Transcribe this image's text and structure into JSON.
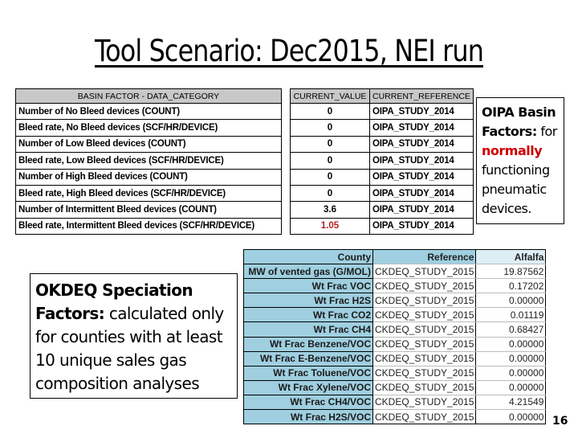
{
  "title": "Tool Scenario: Dec2015, NEI run",
  "basin_table": {
    "headers": [
      "BASIN FACTOR - DATA_CATEGORY",
      "CURRENT_VALUE",
      "CURRENT_REFERENCE"
    ],
    "rows": [
      {
        "category": "Number of No Bleed devices (COUNT)",
        "value": "0",
        "reference": "OIPA_STUDY_2014"
      },
      {
        "category": "Bleed rate, No Bleed devices (SCF/HR/DEVICE)",
        "value": "0",
        "reference": "OIPA_STUDY_2014"
      },
      {
        "category": "Number of Low Bleed devices (COUNT)",
        "value": "0",
        "reference": "OIPA_STUDY_2014"
      },
      {
        "category": "Bleed rate, Low Bleed devices (SCF/HR/DEVICE)",
        "value": "0",
        "reference": "OIPA_STUDY_2014"
      },
      {
        "category": "Number of High Bleed devices (COUNT)",
        "value": "0",
        "reference": "OIPA_STUDY_2014"
      },
      {
        "category": "Bleed rate, High Bleed devices (SCF/HR/DEVICE)",
        "value": "0",
        "reference": "OIPA_STUDY_2014"
      },
      {
        "category": "Number of Intermittent Bleed devices (COUNT)",
        "value": "3.6",
        "reference": "OIPA_STUDY_2014"
      },
      {
        "category": "Bleed rate, Intermittent Bleed devices (SCF/HR/DEVICE)",
        "value": "1.05",
        "reference": "OIPA_STUDY_2014",
        "highlight": true
      }
    ]
  },
  "note_oipa": {
    "bold": "OIPA Basin Factors:",
    "text1": " for ",
    "red": "normally",
    "text2": " functioning pneumatic devices."
  },
  "note_okdeq": {
    "bold": "OKDEQ Speciation Factors:",
    "text": " calculated only for counties with at least 10 unique sales gas composition analyses"
  },
  "okdeq_table": {
    "headers": [
      "County",
      "Reference",
      "Alfalfa"
    ],
    "rows": [
      {
        "label": "MW of vented gas (G/MOL)",
        "reference": "CKDEQ_STUDY_2015",
        "value": "19.87562"
      },
      {
        "label": "Wt Frac VOC",
        "reference": "CKDEQ_STUDY_2015",
        "value": "0.17202"
      },
      {
        "label": "Wt Frac H2S",
        "reference": "CKDEQ_STUDY_2015",
        "value": "0.00000"
      },
      {
        "label": "Wt Frac CO2",
        "reference": "CKDEQ_STUDY_2015",
        "value": "0.01119"
      },
      {
        "label": "Wt Frac CH4",
        "reference": "CKDEQ_STUDY_2015",
        "value": "0.68427"
      },
      {
        "label": "Wt Frac Benzene/VOC",
        "reference": "CKDEQ_STUDY_2015",
        "value": "0.00000"
      },
      {
        "label": "Wt Frac E-Benzene/VOC",
        "reference": "CKDEQ_STUDY_2015",
        "value": "0.00000"
      },
      {
        "label": "Wt Frac Toluene/VOC",
        "reference": "CKDEQ_STUDY_2015",
        "value": "0.00000"
      },
      {
        "label": "Wt Frac Xylene/VOC",
        "reference": "CKDEQ_STUDY_2015",
        "value": "0.00000"
      },
      {
        "label": "Wt Frac CH4/VOC",
        "reference": "CKDEQ_STUDY_2015",
        "value": "4.21549"
      },
      {
        "label": "Wt Frac H2S/VOC",
        "reference": "CKDEQ_STUDY_2015",
        "value": "0.00000"
      }
    ]
  },
  "page_number": "16"
}
